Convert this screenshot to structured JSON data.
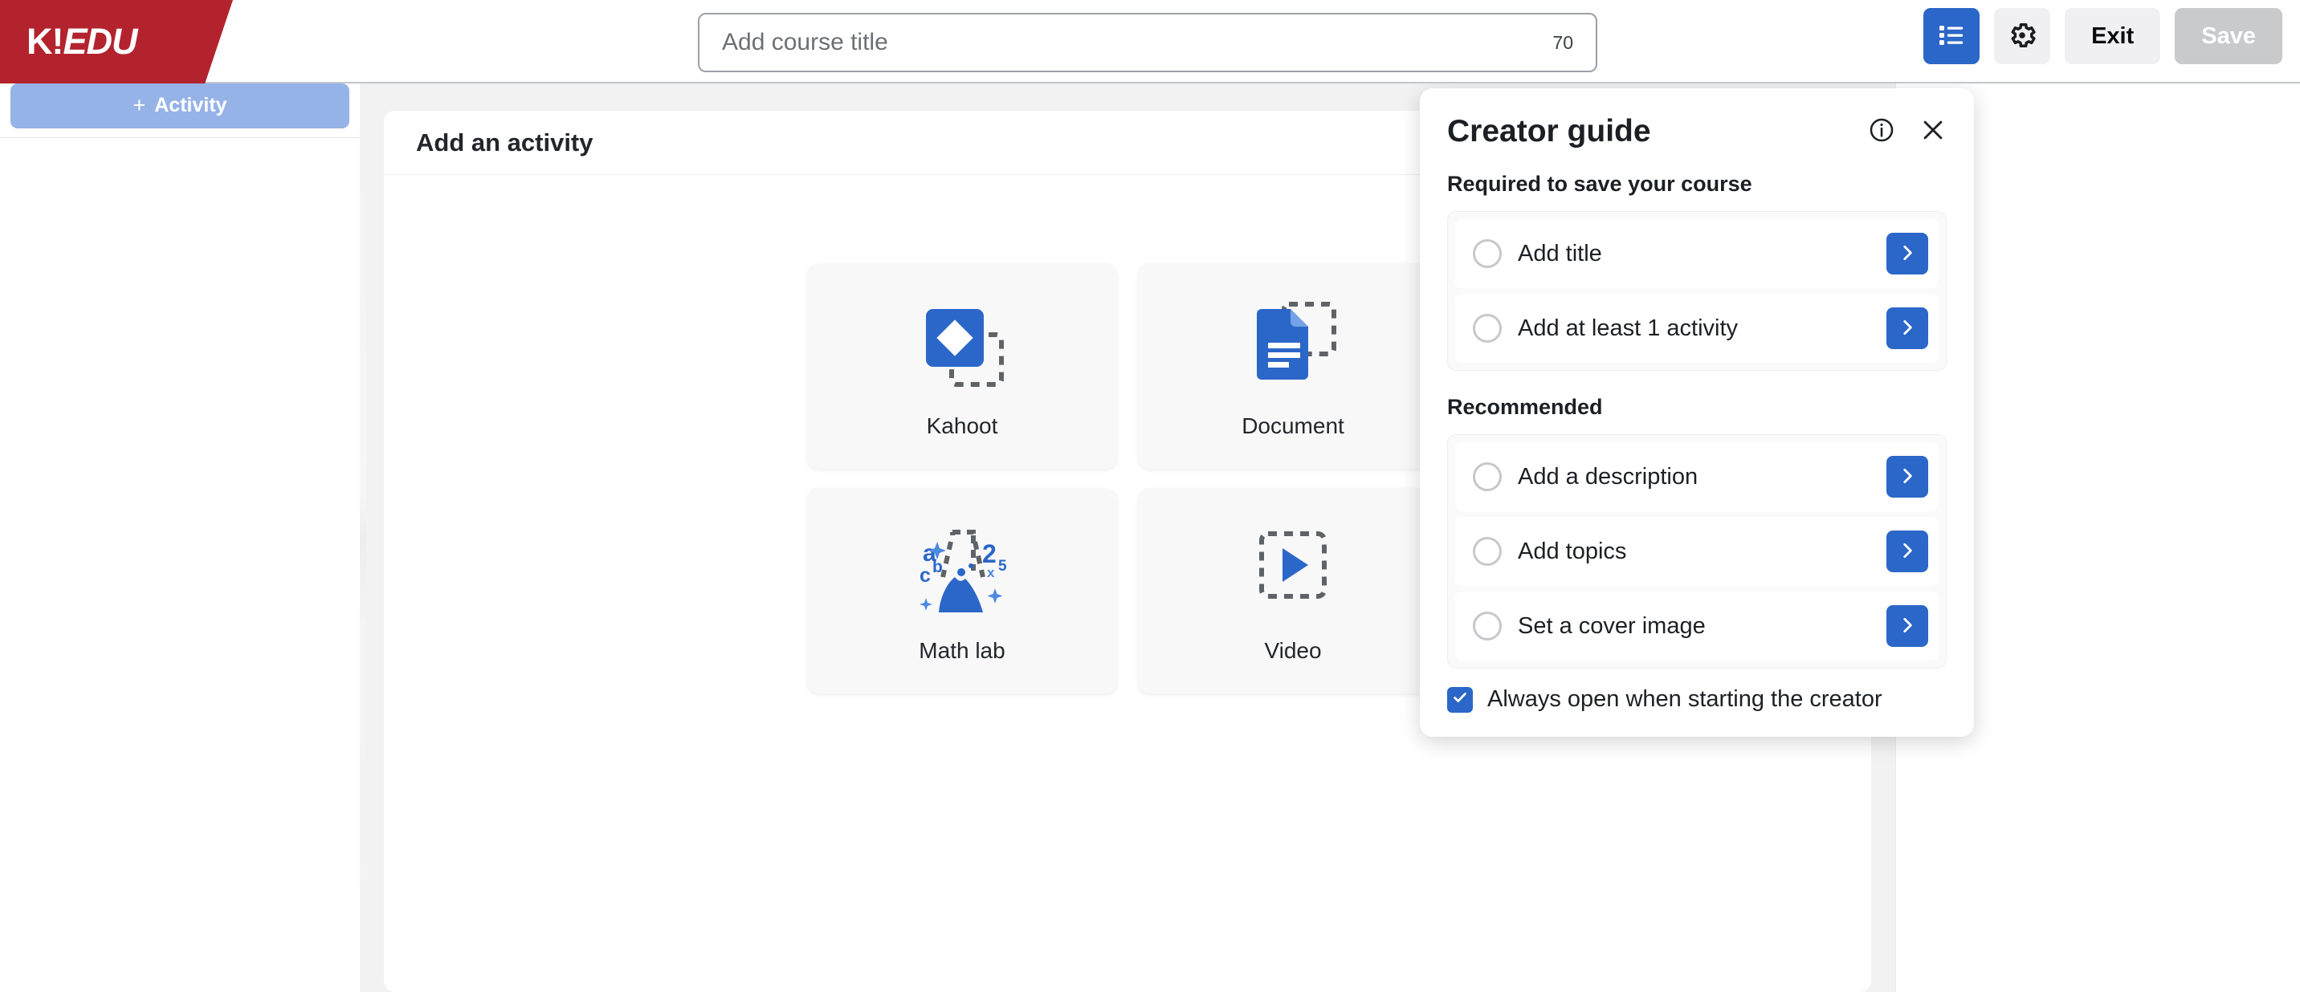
{
  "brand": {
    "logo_k": "K!",
    "logo_suffix": "EDU",
    "logo_bg": "#b3232e",
    "accent_blue": "#2b67c8"
  },
  "topbar": {
    "title_input": {
      "value": "",
      "placeholder": "Add course title"
    },
    "char_count": "70",
    "checklist_icon": "checklist-icon",
    "settings_icon": "gear-icon",
    "exit_label": "Exit",
    "save_label": "Save"
  },
  "sidebar": {
    "add_activity_label": "Activity",
    "add_activity_plus": "+"
  },
  "main": {
    "panel_title": "Add an activity",
    "cards": [
      {
        "label": "Kahoot",
        "icon": "kahoot-icon"
      },
      {
        "label": "Document",
        "icon": "document-icon"
      },
      {
        "label": "Math lab",
        "icon": "math-lab-icon"
      },
      {
        "label": "Video",
        "icon": "video-icon"
      }
    ]
  },
  "creator_guide": {
    "title": "Creator guide",
    "info_icon": "info-icon",
    "close_icon": "close-icon",
    "required_section_title": "Required to save your course",
    "required_items": [
      {
        "label": "Add title"
      },
      {
        "label": "Add at least 1 activity"
      }
    ],
    "recommended_section_title": "Recommended",
    "recommended_items": [
      {
        "label": "Add a description"
      },
      {
        "label": "Add topics"
      },
      {
        "label": "Set a cover image"
      }
    ],
    "always_open_label": "Always open when starting the creator",
    "always_open_checked": true
  }
}
